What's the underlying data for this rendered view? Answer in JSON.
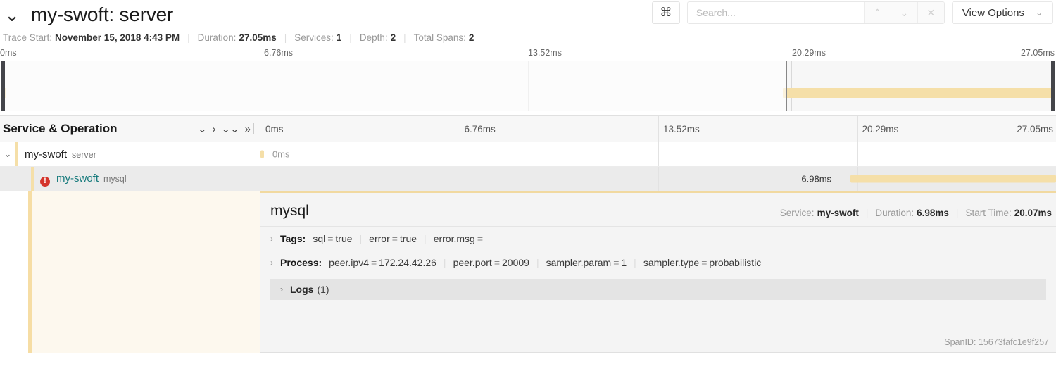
{
  "header": {
    "caret_icon": "chevron-down-icon",
    "trace_title": "my-swoft: server",
    "kbd_icon": "command-key-icon",
    "search_placeholder": "Search...",
    "search_value": "",
    "prev_icon": "chevron-up-icon",
    "next_icon": "chevron-down-icon",
    "clear_icon": "close-icon",
    "view_options_label": "View Options",
    "view_options_caret": "chevron-down-icon"
  },
  "meta": {
    "trace_start_key": "Trace Start:",
    "trace_start_value": "November 15, 2018 4:43 PM",
    "duration_key": "Duration:",
    "duration_value": "27.05ms",
    "services_key": "Services:",
    "services_value": "1",
    "depth_key": "Depth:",
    "depth_value": "2",
    "total_spans_key": "Total Spans:",
    "total_spans_value": "2"
  },
  "minimap": {
    "ticks": [
      "0ms",
      "6.76ms",
      "13.52ms",
      "20.29ms",
      "27.05ms"
    ],
    "selection_start_pct": 74.5,
    "selection_end_pct": 100,
    "span_start_pct": 74.2,
    "span_end_pct": 99.8
  },
  "timeline_header": {
    "column_title": "Service & Operation",
    "controls": [
      {
        "name": "collapse-one-icon",
        "glyph": "⌄"
      },
      {
        "name": "expand-one-icon",
        "glyph": "›"
      },
      {
        "name": "collapse-all-icon",
        "glyph": "»"
      },
      {
        "name": "expand-all-icon",
        "glyph": "»"
      }
    ],
    "ticks": [
      "0ms",
      "6.76ms",
      "13.52ms",
      "20.29ms",
      "27.05ms"
    ]
  },
  "spans": [
    {
      "caret_icon": "chevron-down-icon",
      "service": "my-swoft",
      "operation": "server",
      "has_error": false,
      "selected": false,
      "bar_label": "0ms",
      "bar_start_pct": 0,
      "bar_width_pct": 0.4,
      "label_left_pct": 1.5
    },
    {
      "caret_icon": "",
      "service": "my-swoft",
      "operation": "mysql",
      "has_error": true,
      "error_icon": "error-exclamation-icon",
      "selected": true,
      "bar_label": "6.98ms",
      "bar_start_pct": 74.2,
      "bar_width_pct": 25.8,
      "label_left_pct": 68.0
    }
  ],
  "detail": {
    "title": "mysql",
    "service_key": "Service:",
    "service_value": "my-swoft",
    "duration_key": "Duration:",
    "duration_value": "6.98ms",
    "start_time_key": "Start Time:",
    "start_time_value": "20.07ms",
    "tags_caret": "chevron-right-icon",
    "tags_key": "Tags:",
    "tags": [
      {
        "k": "sql",
        "v": "true"
      },
      {
        "k": "error",
        "v": "true"
      },
      {
        "k": "error.msg",
        "v": ""
      }
    ],
    "process_caret": "chevron-right-icon",
    "process_key": "Process:",
    "process": [
      {
        "k": "peer.ipv4",
        "v": "172.24.42.26"
      },
      {
        "k": "peer.port",
        "v": "20009"
      },
      {
        "k": "sampler.param",
        "v": "1"
      },
      {
        "k": "sampler.type",
        "v": "probabilistic"
      }
    ],
    "logs_caret": "chevron-right-icon",
    "logs_label": "Logs",
    "logs_count": "(1)",
    "span_id_key": "SpanID:",
    "span_id_value": "15673fafc1e9f257"
  },
  "colors": {
    "span_bar": "#f5dfa8",
    "error": "#d4342b",
    "error_service_text": "#167a7c",
    "selected_row": "#ebebeb"
  }
}
